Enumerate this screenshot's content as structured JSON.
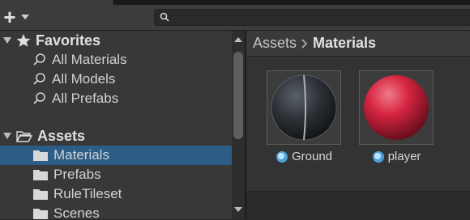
{
  "toolbar": {
    "search": {
      "placeholder": ""
    }
  },
  "left_tree": {
    "favorites": {
      "label": "Favorites",
      "items": [
        {
          "label": "All Materials"
        },
        {
          "label": "All Models"
        },
        {
          "label": "All Prefabs"
        }
      ]
    },
    "assets": {
      "label": "Assets",
      "items": [
        {
          "label": "Materials",
          "selected": true
        },
        {
          "label": "Prefabs"
        },
        {
          "label": "RuleTileset"
        },
        {
          "label": "Scenes"
        }
      ]
    }
  },
  "breadcrumb": {
    "root": "Assets",
    "current": "Materials"
  },
  "assets": [
    {
      "name": "Ground",
      "color": "#2e3238"
    },
    {
      "name": "player",
      "color": "#c81e3a"
    }
  ],
  "colors": {
    "selection": "#2c5d87",
    "accent": "#4ea1d8"
  }
}
